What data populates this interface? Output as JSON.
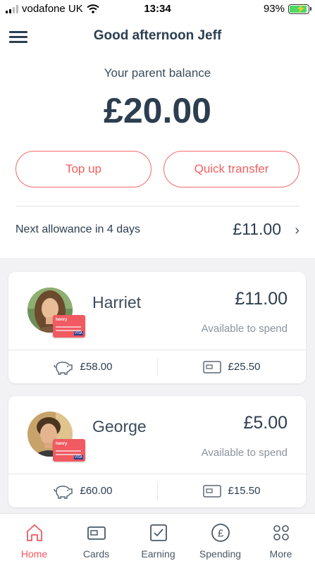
{
  "status_bar": {
    "carrier": "vodafone UK",
    "time": "13:34",
    "battery": "93%"
  },
  "header": {
    "greeting": "Good afternoon Jeff"
  },
  "balance": {
    "label": "Your parent balance",
    "amount": "£20.00"
  },
  "actions": {
    "top_up": "Top up",
    "quick_transfer": "Quick transfer"
  },
  "allowance": {
    "label": "Next allowance in 4 days",
    "amount": "£11.00"
  },
  "children": [
    {
      "name": "Harriet",
      "amount": "£11.00",
      "sub": "Available to spend",
      "savings": "£58.00",
      "card": "£25.50"
    },
    {
      "name": "George",
      "amount": "£5.00",
      "sub": "Available to spend",
      "savings": "£60.00",
      "card": "£15.50"
    }
  ],
  "tabs": [
    {
      "label": "Home",
      "icon": "home-icon",
      "active": true
    },
    {
      "label": "Cards",
      "icon": "card-icon",
      "active": false
    },
    {
      "label": "Earning",
      "icon": "checkbox-icon",
      "active": false
    },
    {
      "label": "Spending",
      "icon": "pound-icon",
      "active": false
    },
    {
      "label": "More",
      "icon": "more-icon",
      "active": false
    }
  ],
  "colors": {
    "accent": "#f05a60",
    "text": "#2c3e50",
    "background": "#f2f2f4"
  }
}
